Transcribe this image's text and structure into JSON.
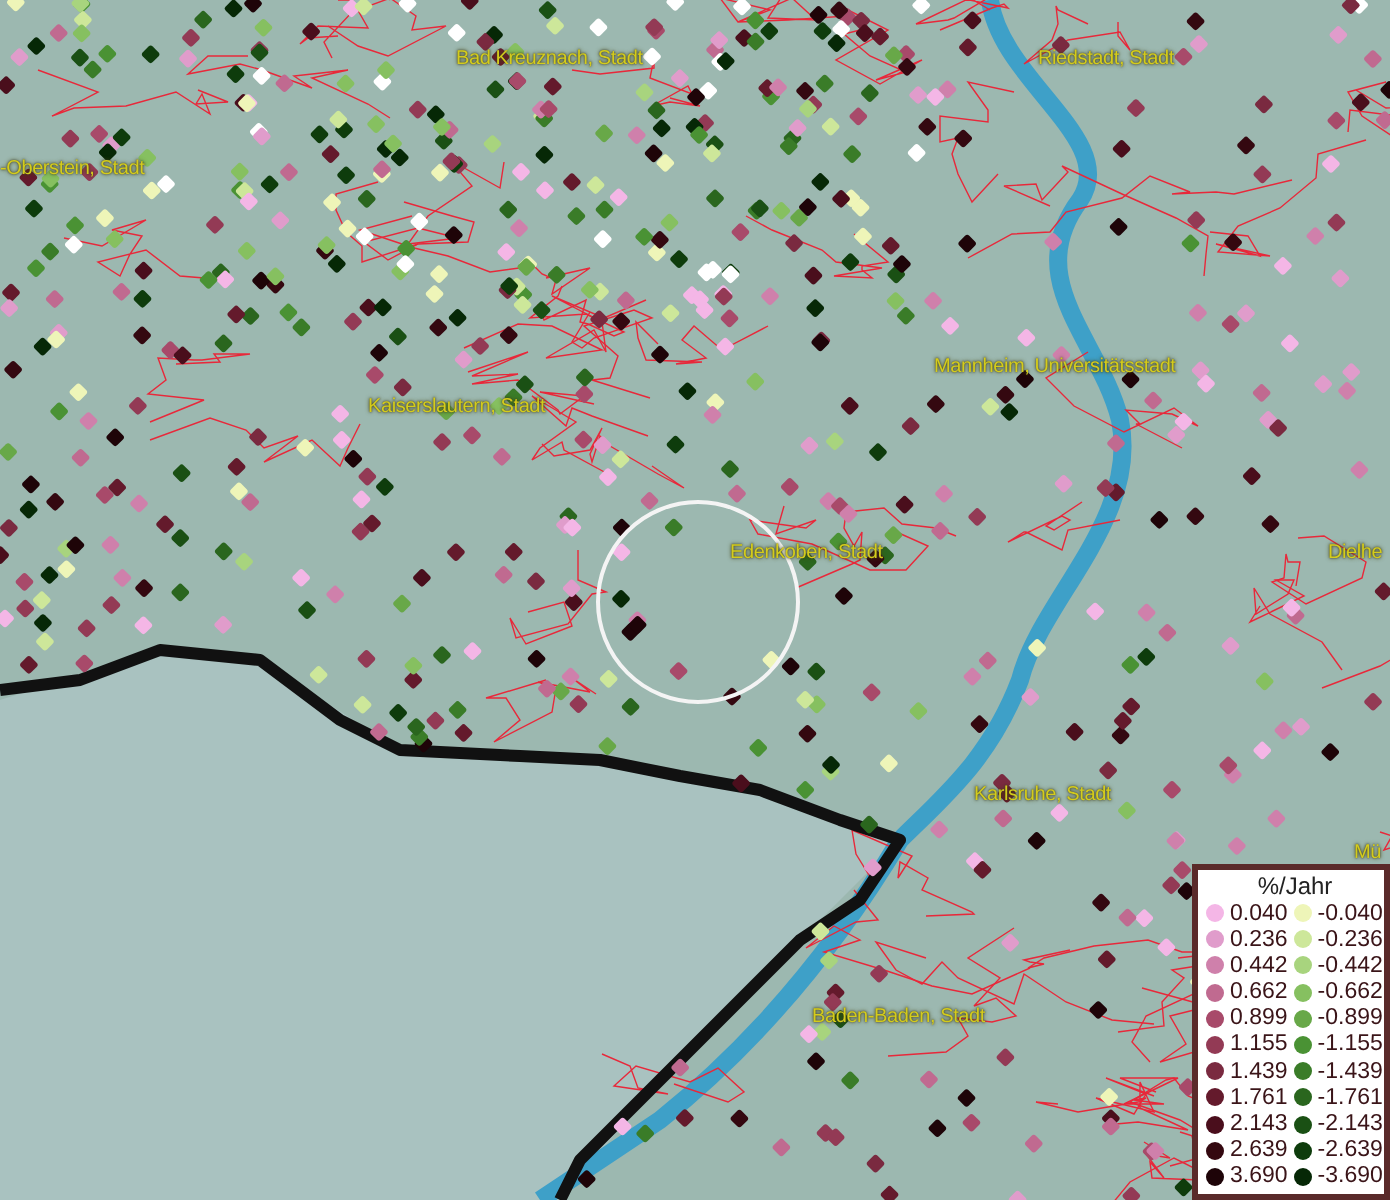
{
  "map": {
    "places": [
      {
        "text": "Bad Kreuznach, Stadt"
      },
      {
        "text": "Riedstadt, Stadt"
      },
      {
        "text": "-Oberstein, Stadt"
      },
      {
        "text": "Kaiserslautern, Stadt"
      },
      {
        "text": "Mannheim, Universitätsstadt"
      },
      {
        "text": "Edenkoben, Stadt"
      },
      {
        "text": "Dielhe"
      },
      {
        "text": "Karlsruhe, Stadt"
      },
      {
        "text": "Mü"
      },
      {
        "text": "Baden-Baden, Stadt"
      }
    ]
  },
  "legend": {
    "title": "%/Jahr",
    "positive": [
      {
        "label": "0.040",
        "color": "#f4b6e6"
      },
      {
        "label": "0.236",
        "color": "#e09ccb"
      },
      {
        "label": "0.442",
        "color": "#cf80ab"
      },
      {
        "label": "0.662",
        "color": "#c06a90"
      },
      {
        "label": "0.899",
        "color": "#a84a6a"
      },
      {
        "label": "1.155",
        "color": "#933a55"
      },
      {
        "label": "1.439",
        "color": "#7a2a40"
      },
      {
        "label": "1.761",
        "color": "#641a2c"
      },
      {
        "label": "2.143",
        "color": "#4a0e1c"
      },
      {
        "label": "2.639",
        "color": "#340810"
      },
      {
        "label": "3.690",
        "color": "#1e0408"
      }
    ],
    "negative": [
      {
        "label": "-0.040",
        "color": "#eef5b8"
      },
      {
        "label": "-0.236",
        "color": "#cde79a"
      },
      {
        "label": "-0.442",
        "color": "#a8d47e"
      },
      {
        "label": "-0.662",
        "color": "#86c060"
      },
      {
        "label": "-0.899",
        "color": "#68a848"
      },
      {
        "label": "-1.155",
        "color": "#4a9234"
      },
      {
        "label": "-1.439",
        "color": "#3a7c28"
      },
      {
        "label": "-1.761",
        "color": "#2a661e"
      },
      {
        "label": "-2.143",
        "color": "#1a5014"
      },
      {
        "label": "-2.639",
        "color": "#0e3c0c"
      },
      {
        "label": "-3.690",
        "color": "#062806"
      }
    ]
  }
}
